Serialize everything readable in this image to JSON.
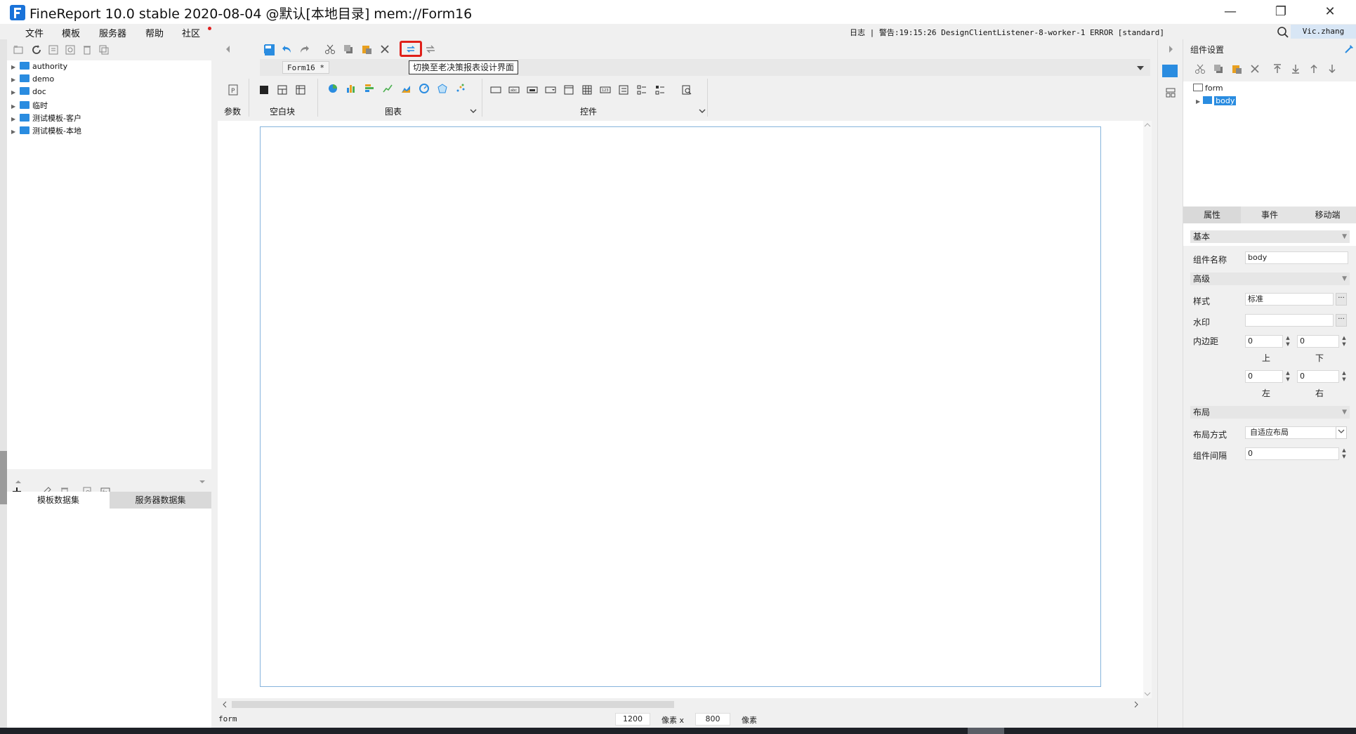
{
  "window": {
    "title": "FineReport 10.0 stable 2020-08-04 @默认[本地目录]    mem://Form16",
    "minimize": "—",
    "maximize": "❐",
    "close": "✕"
  },
  "menu": {
    "items": [
      "文件",
      "模板",
      "服务器",
      "帮助",
      "社区"
    ],
    "log": "日志 | 警告:19:15:26 DesignClientListener-8-worker-1 ERROR [standard]",
    "user": "Vic.zhang"
  },
  "template_tree": {
    "items": [
      "authority",
      "demo",
      "doc",
      "临时",
      "测试模板-客户",
      "测试模板-本地"
    ]
  },
  "dataset_tabs": [
    "模板数据集",
    "服务器数据集"
  ],
  "editor": {
    "form_tab": "Form16 *",
    "tooltip": "切换至老决策报表设计界面",
    "widget_groups": {
      "param": "参数",
      "blank": "空白块",
      "chart": "图表",
      "control": "控件"
    },
    "status": {
      "name": "form",
      "width": "1200",
      "unit1": "像素 x",
      "height": "800",
      "unit2": "像素"
    }
  },
  "right_panel": {
    "header": "组件设置",
    "tree": {
      "root": "form",
      "child": "body"
    },
    "tabs": [
      "属性",
      "事件",
      "移动端"
    ],
    "sections": {
      "basic": "基本",
      "advanced": "高级",
      "layout": "布局"
    },
    "fields": {
      "comp_name_label": "组件名称",
      "comp_name": "body",
      "style_label": "样式",
      "style": "标准",
      "watermark_label": "水印",
      "watermark": "",
      "padding_label": "内边距",
      "pad_top": "0",
      "pad_bottom": "0",
      "pad_left": "0",
      "pad_right": "0",
      "top": "上",
      "bottom": "下",
      "left": "左",
      "right": "右",
      "layout_mode_label": "布局方式",
      "layout_mode": "自适应布局",
      "gap_label": "组件间隔",
      "gap": "0"
    }
  },
  "colors": {
    "accent": "#2a8ce0",
    "highlight": "#e0201a",
    "canvas_border": "#86b4dc"
  }
}
